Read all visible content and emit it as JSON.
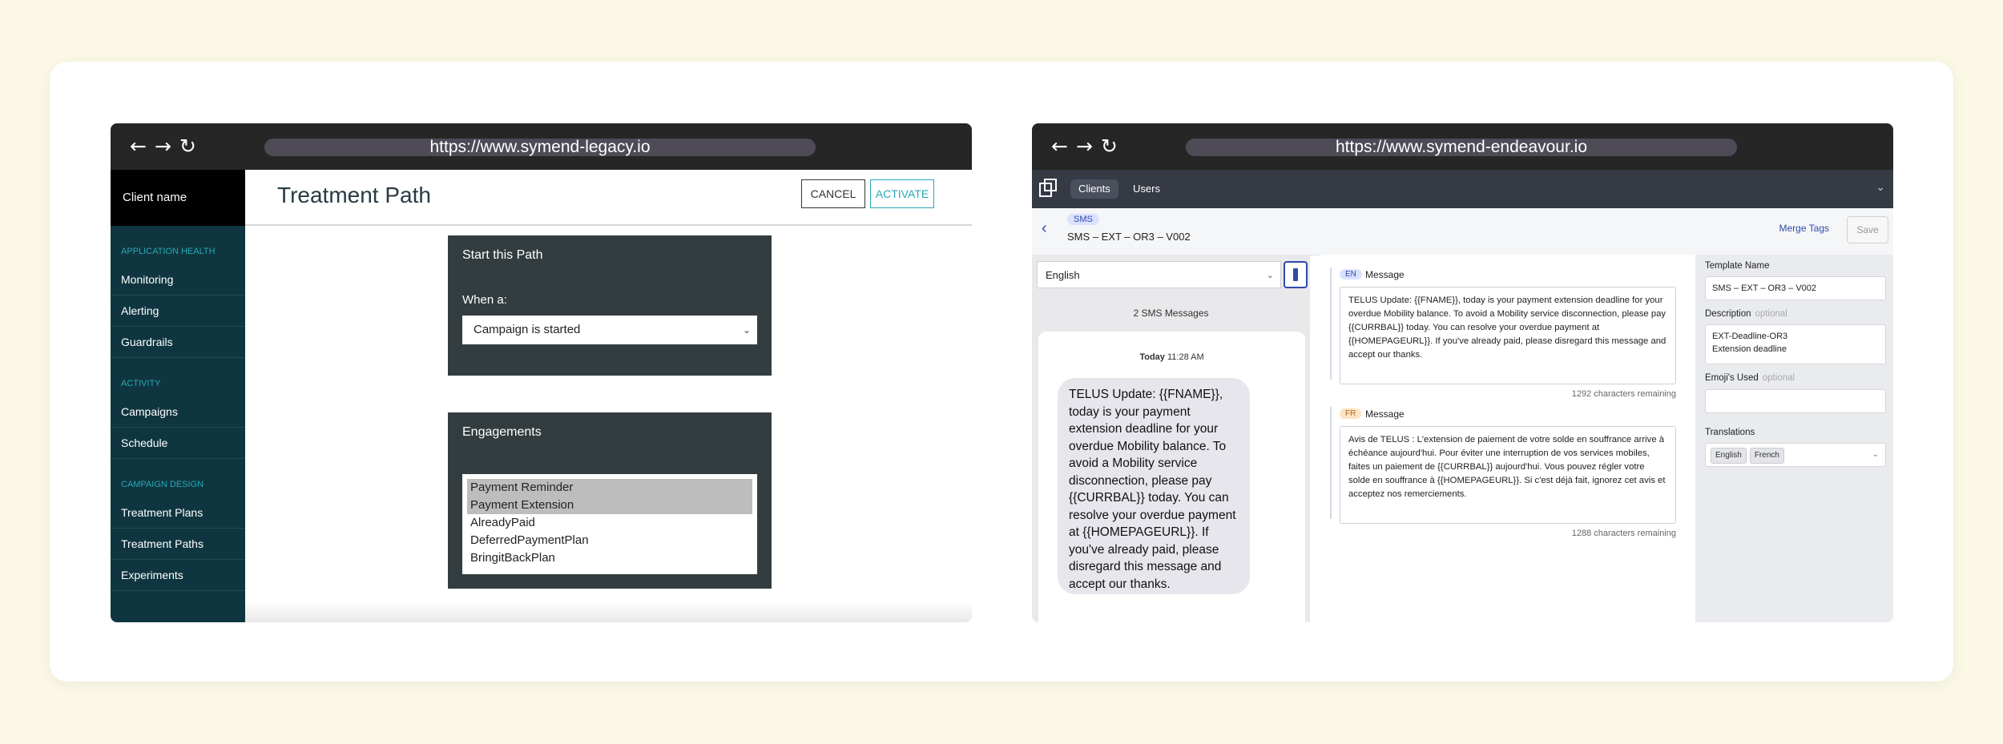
{
  "nav_icons": [
    "←",
    "→",
    "↻"
  ],
  "legacy": {
    "url": "https://www.symend-legacy.io",
    "client_name": "Client name",
    "sidebar": [
      {
        "section": "APPLICATION HEALTH",
        "items": [
          "Monitoring",
          "Alerting",
          "Guardrails"
        ]
      },
      {
        "section": "ACTIVITY",
        "items": [
          "Campaigns",
          "Schedule"
        ]
      },
      {
        "section": "CAMPAIGN DESIGN",
        "items": [
          "Treatment Plans",
          "Treatment Paths",
          "Experiments"
        ]
      }
    ],
    "page_title": "Treatment Path",
    "cancel_label": "CANCEL",
    "activate_label": "ACTIVATE",
    "start_panel": {
      "title": "Start this Path",
      "when_label": "When a:",
      "when_value": "Campaign is started"
    },
    "engagements": {
      "title": "Engagements",
      "options": [
        {
          "label": "Payment Reminder",
          "selected": true
        },
        {
          "label": "Payment Extension",
          "selected": true
        },
        {
          "label": "AlreadyPaid",
          "selected": false
        },
        {
          "label": "DeferredPaymentPlan",
          "selected": false
        },
        {
          "label": "BringitBackPlan",
          "selected": false
        }
      ]
    }
  },
  "endeavour": {
    "url": "https://www.symend-endeavour.io",
    "tabs": [
      "Clients",
      "Users"
    ],
    "channel_badge": "SMS",
    "template_title": "SMS – EXT – OR3 – V002",
    "merge_tags_label": "Merge Tags",
    "save_label": "Save",
    "language_select": "English",
    "sms_count": "2 SMS Messages",
    "time_day": "Today",
    "time_value": "11:28 AM",
    "preview_text": "TELUS Update: {{FNAME}}, today is your payment extension deadline for your overdue Mobility balance. To avoid a Mobility service disconnection, please pay {{CURRBAL}} today. You can resolve your overdue payment at {{HOMEPAGEURL}}. If you've already paid, please disregard this message and accept our thanks.",
    "messages": [
      {
        "lang": "EN",
        "label": "Message",
        "text": "TELUS Update: {{FNAME}}, today is your payment extension deadline for your overdue Mobility balance. To avoid a Mobility service disconnection, please pay {{CURRBAL}} today. You can resolve your overdue payment at {{HOMEPAGEURL}}. If you've already paid, please disregard this message and accept our thanks.",
        "remaining": "1292 characters remaining"
      },
      {
        "lang": "FR",
        "label": "Message",
        "text": "Avis de TELUS : L'extension de paiement de votre solde en souffrance arrive à échéance aujourd'hui. Pour éviter une interruption de vos services mobiles, faites un paiement de {{CURRBAL}} aujourd'hui. Vous pouvez régler votre solde en souffrance à {{HOMEPAGEURL}}. Si c'est déjà fait, ignorez cet avis et acceptez nos remerciements.",
        "remaining": "1288 characters remaining"
      }
    ],
    "form": {
      "template_name_label": "Template Name",
      "template_name_value": "SMS – EXT – OR3 – V002",
      "description_label": "Description",
      "description_hint": "optional",
      "description_value": "EXT-Deadline-OR3\nExtension deadline",
      "emoji_label": "Emoji's Used",
      "emoji_hint": "optional",
      "translations_label": "Translations",
      "translations": [
        "English",
        "French"
      ]
    }
  }
}
